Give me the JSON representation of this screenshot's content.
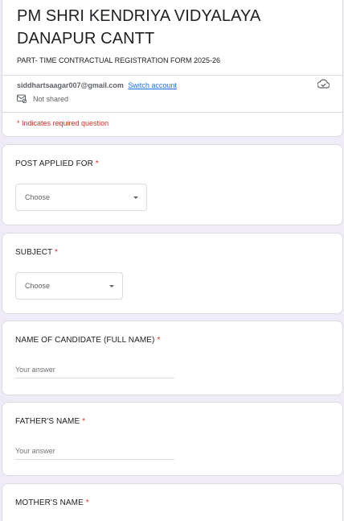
{
  "header": {
    "title": " PM SHRI KENDRIYA VIDYALAYA DANAPUR CANTT",
    "description": "PART- TIME CONTRACTUAL REGISTRATION FORM 2025-26",
    "account_email": "siddhartsaagar007@gmail.com",
    "switch_account_label": "Switch account",
    "not_shared_label": "Not shared",
    "required_note": "* Indicates required question",
    "icons": [
      "cloud-icon",
      "not-shared-icon"
    ]
  },
  "questions": [
    {
      "label": "POST APPLIED FOR",
      "required_marker": "*",
      "type": "dropdown",
      "value": "Choose"
    },
    {
      "label": "SUBJECT",
      "required_marker": "*",
      "type": "dropdown",
      "value": "Choose"
    },
    {
      "label": "NAME OF CANDIDATE (FULL NAME)",
      "required_marker": "*",
      "type": "short_answer",
      "placeholder": "Your answer"
    },
    {
      "label": "FATHER'S NAME",
      "required_marker": "*",
      "type": "short_answer",
      "placeholder": "Your answer"
    },
    {
      "label": "MOTHER'S NAME",
      "required_marker": "*",
      "type": "short_answer"
    }
  ],
  "colors": {
    "background": "#f0ebf8",
    "required": "#d93025",
    "link": "#1a73e8"
  }
}
